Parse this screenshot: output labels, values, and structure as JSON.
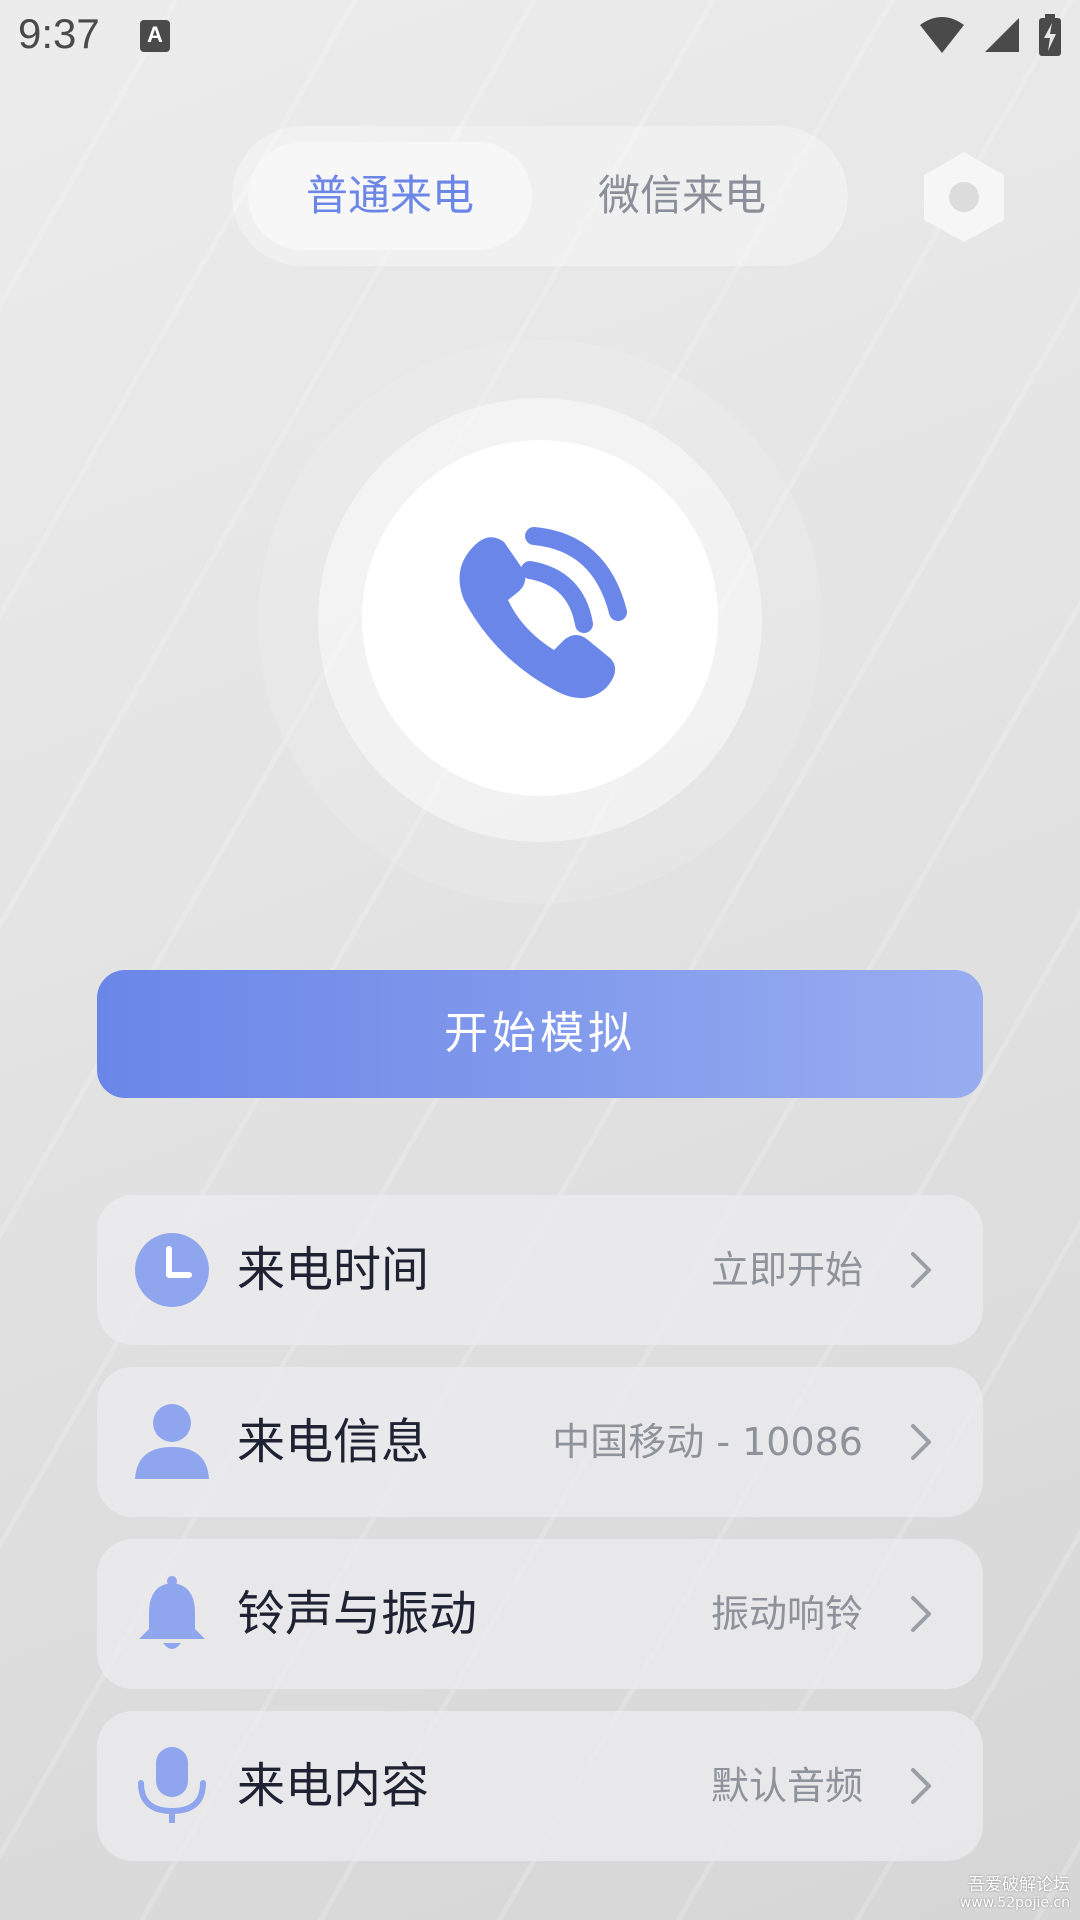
{
  "status_bar": {
    "time": "9:37",
    "keyboard_indicator": "A",
    "icons": [
      "wifi-icon",
      "signal-icon",
      "battery-charging-icon"
    ]
  },
  "tabs": [
    {
      "label": "普通来电",
      "active": true
    },
    {
      "label": "微信来电",
      "active": false
    }
  ],
  "colors": {
    "accent": "#6c86e6",
    "button_gradient_start": "#6a86e8",
    "button_gradient_end": "#98adf0",
    "card_icon": "#8fa6ee"
  },
  "main": {
    "call_icon": "phone-call-icon",
    "start_button_label": "开始模拟"
  },
  "settings": [
    {
      "icon": "clock-icon",
      "title": "来电时间",
      "value": "立即开始"
    },
    {
      "icon": "user-icon",
      "title": "来电信息",
      "value": "中国移动 - 10086"
    },
    {
      "icon": "bell-icon",
      "title": "铃声与振动",
      "value": "振动响铃"
    },
    {
      "icon": "microphone-icon",
      "title": "来电内容",
      "value": "默认音频"
    }
  ],
  "watermark": {
    "line1": "吾爱破解论坛",
    "line2": "www.52pojie.cn"
  }
}
